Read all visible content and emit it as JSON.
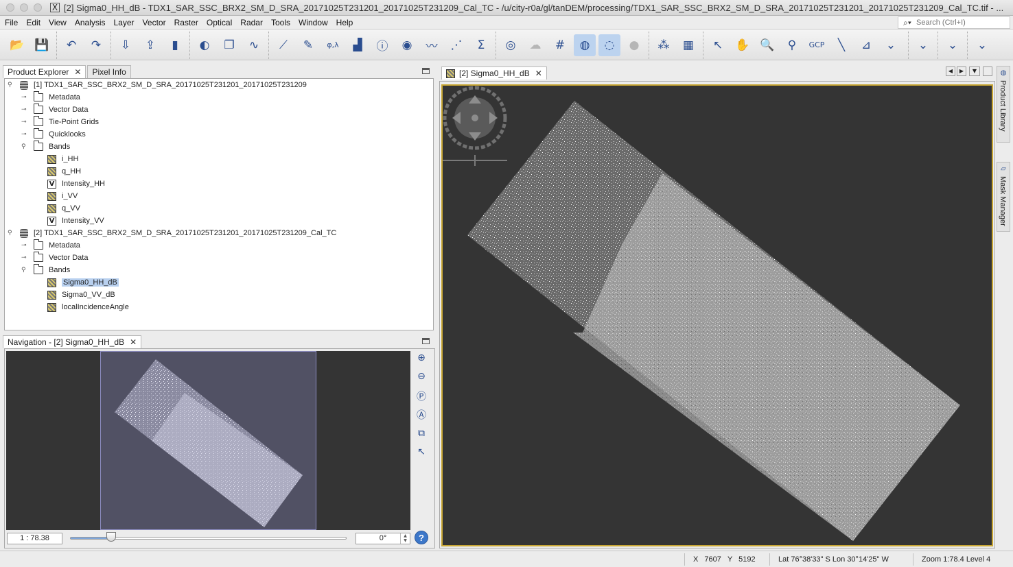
{
  "window": {
    "title": "[2] Sigma0_HH_dB - TDX1_SAR_SSC_BRX2_SM_D_SRA_20171025T231201_20171025T231209_Cal_TC - /u/city-r0a/gl/tanDEM/processing/TDX1_SAR_SSC_BRX2_SM_D_SRA_20171025T231201_20171025T231209_Cal_TC.tif - ..."
  },
  "menu": {
    "items": [
      "File",
      "Edit",
      "View",
      "Analysis",
      "Layer",
      "Vector",
      "Raster",
      "Optical",
      "Radar",
      "Tools",
      "Window",
      "Help"
    ],
    "search_placeholder": "Search (Ctrl+I)"
  },
  "toolbar": {
    "groups": [
      [
        {
          "icon": "open-folder-icon",
          "glyph": "📂"
        },
        {
          "icon": "save-icon",
          "glyph": "💾"
        }
      ],
      [
        {
          "icon": "undo-icon",
          "glyph": "↶"
        },
        {
          "icon": "redo-icon",
          "glyph": "↷"
        }
      ],
      [
        {
          "icon": "import-icon",
          "glyph": "⇩"
        },
        {
          "icon": "export-icon",
          "glyph": "⇪"
        },
        {
          "icon": "product-icon",
          "glyph": "▮"
        }
      ],
      [
        {
          "icon": "rgb-icon",
          "glyph": "◐"
        },
        {
          "icon": "layers-icon",
          "glyph": "❐"
        },
        {
          "icon": "wave-icon",
          "glyph": "∿"
        }
      ],
      [
        {
          "icon": "profile-plot-icon",
          "glyph": "⟋"
        },
        {
          "icon": "edit-icon",
          "glyph": "✎"
        },
        {
          "icon": "geo-coding-icon",
          "glyph": "φ,λ"
        },
        {
          "icon": "histogram-icon",
          "glyph": "▟"
        },
        {
          "icon": "information-icon",
          "glyph": "ⓘ"
        },
        {
          "icon": "statistics-icon",
          "glyph": "◉"
        },
        {
          "icon": "spectrum-icon",
          "glyph": "〰"
        },
        {
          "icon": "scatter-plot-icon",
          "glyph": "⋰"
        },
        {
          "icon": "sigma-icon",
          "glyph": "Σ"
        }
      ],
      [
        {
          "icon": "overlay-eye-icon",
          "glyph": "◎",
          "state": "normal"
        },
        {
          "icon": "pins-icon",
          "glyph": "☁",
          "state": "dim"
        },
        {
          "icon": "graticule-icon",
          "glyph": "#",
          "state": "normal"
        },
        {
          "icon": "world-map-icon",
          "glyph": "◍",
          "state": "on"
        },
        {
          "icon": "gcp-overlay-icon",
          "glyph": "◌",
          "state": "on"
        },
        {
          "icon": "shape-overlay-icon",
          "glyph": "●",
          "state": "dim"
        }
      ],
      [
        {
          "icon": "graph-builder-icon",
          "glyph": "⁂"
        },
        {
          "icon": "batch-processing-icon",
          "glyph": "▦"
        }
      ],
      [
        {
          "icon": "select-tool-icon",
          "glyph": "↖"
        },
        {
          "icon": "pan-tool-icon",
          "glyph": "✋"
        },
        {
          "icon": "zoom-tool-icon",
          "glyph": "🔍"
        },
        {
          "icon": "pin-placing-icon",
          "glyph": "⚲"
        },
        {
          "icon": "gcp-placing-icon",
          "glyph": "GCP"
        },
        {
          "icon": "line-drawing-icon",
          "glyph": "╲"
        },
        {
          "icon": "polyline-icon",
          "glyph": "⊿"
        },
        {
          "icon": "more-chevron-icon",
          "glyph": "⌄"
        }
      ],
      [
        {
          "icon": "more-chevron-icon",
          "glyph": "⌄"
        }
      ],
      [
        {
          "icon": "more-chevron-icon",
          "glyph": "⌄"
        }
      ],
      [
        {
          "icon": "more-chevron-icon",
          "glyph": "⌄"
        }
      ]
    ]
  },
  "explorer": {
    "tabs": [
      "Product Explorer",
      "Pixel Info"
    ],
    "tree": [
      {
        "level": 0,
        "icon": "database",
        "toggle": "open",
        "label": "[1] TDX1_SAR_SSC_BRX2_SM_D_SRA_20171025T231201_20171025T231209"
      },
      {
        "level": 1,
        "icon": "folder",
        "toggle": "closed",
        "label": "Metadata"
      },
      {
        "level": 1,
        "icon": "folder",
        "toggle": "closed",
        "label": "Vector Data"
      },
      {
        "level": 1,
        "icon": "folder",
        "toggle": "closed",
        "label": "Tie-Point Grids"
      },
      {
        "level": 1,
        "icon": "folder",
        "toggle": "closed",
        "label": "Quicklooks"
      },
      {
        "level": 1,
        "icon": "folder",
        "toggle": "open",
        "label": "Bands"
      },
      {
        "level": 2,
        "icon": "band",
        "label": "i_HH"
      },
      {
        "level": 2,
        "icon": "band",
        "label": "q_HH"
      },
      {
        "level": 2,
        "icon": "virtual",
        "label": "Intensity_HH"
      },
      {
        "level": 2,
        "icon": "band",
        "label": "i_VV"
      },
      {
        "level": 2,
        "icon": "band",
        "label": "q_VV"
      },
      {
        "level": 2,
        "icon": "virtual",
        "label": "Intensity_VV"
      },
      {
        "level": 0,
        "icon": "database",
        "toggle": "open",
        "label": "[2] TDX1_SAR_SSC_BRX2_SM_D_SRA_20171025T231201_20171025T231209_Cal_TC"
      },
      {
        "level": 1,
        "icon": "folder",
        "toggle": "closed",
        "label": "Metadata"
      },
      {
        "level": 1,
        "icon": "folder",
        "toggle": "closed",
        "label": "Vector Data"
      },
      {
        "level": 1,
        "icon": "folder",
        "toggle": "open",
        "label": "Bands"
      },
      {
        "level": 2,
        "icon": "band",
        "label": "Sigma0_HH_dB",
        "selected": true
      },
      {
        "level": 2,
        "icon": "band",
        "label": "Sigma0_VV_dB"
      },
      {
        "level": 2,
        "icon": "band",
        "label": "localIncidenceAngle"
      }
    ],
    "virtual_glyph": "V"
  },
  "navigation": {
    "tab": "Navigation - [2] Sigma0_HH_dB",
    "scale": "1 : 78.38",
    "zoom_slider_fraction": 0.15,
    "angle": "0°"
  },
  "image_view": {
    "tab": "[2] Sigma0_HH_dB"
  },
  "side_panels": {
    "product_library": "Product Library",
    "mask_manager": "Mask Manager"
  },
  "status": {
    "x_label": "X",
    "x": "7607",
    "y_label": "Y",
    "y": "5192",
    "lat_lon": "Lat 76°38'33\" S  Lon 30°14'25\" W",
    "zoom": "Zoom 1:78.4  Level 4"
  },
  "colors": {
    "selection": "#b8d0ef",
    "view_border": "#c8a633",
    "background_dark": "#343434",
    "nav_window": "#515164"
  }
}
